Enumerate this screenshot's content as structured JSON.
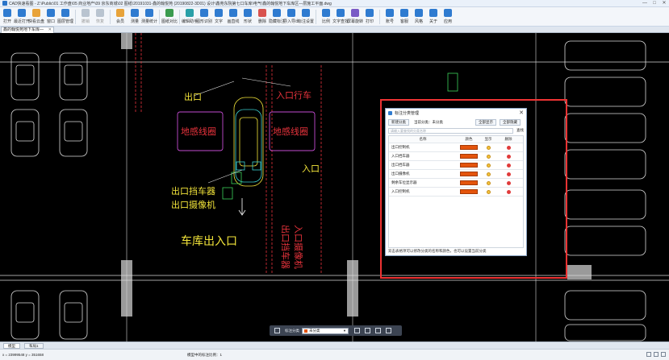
{
  "window": {
    "title": "CAD快速看图 - Z:\\Public\\01 工作盘\\05 商业地产\\09 京东商城\\02 图纸\\20191031-鑫的翰悦苑 (20190822-3D01) 设计\\鑫苑东院第七口车库\\电气\\鑫的翰悦地下车库区—层施工平面.dwg",
    "minimize": "—",
    "maximize": "□",
    "close": "✕"
  },
  "toolbar": {
    "items": [
      {
        "label": "打开",
        "icon": "open-icon",
        "enabled": true
      },
      {
        "label": "最近打开",
        "icon": "recent-icon",
        "enabled": true
      },
      {
        "label": "快看云盘",
        "icon": "cloud-icon",
        "enabled": true
      },
      {
        "label": "窗口",
        "icon": "window-icon",
        "enabled": true
      },
      {
        "label": "图层管理",
        "icon": "layers-icon",
        "enabled": true
      },
      {
        "label": "撤销",
        "icon": "undo-icon",
        "enabled": false
      },
      {
        "label": "恢复",
        "icon": "redo-icon",
        "enabled": false
      },
      {
        "label": "会员",
        "icon": "vip-icon",
        "enabled": true
      },
      {
        "label": "测量",
        "icon": "measure-icon",
        "enabled": true
      },
      {
        "label": "测量统计",
        "icon": "measure-stats-icon",
        "enabled": true
      },
      {
        "label": "图纸对比",
        "icon": "compare-icon",
        "enabled": true
      },
      {
        "label": "编辑助手",
        "icon": "edit-assistant-icon",
        "enabled": true
      },
      {
        "label": "图形识别",
        "icon": "shape-recognize-icon",
        "enabled": true
      },
      {
        "label": "文字",
        "icon": "text-icon",
        "enabled": true
      },
      {
        "label": "画直线",
        "icon": "line-icon",
        "enabled": true
      },
      {
        "label": "形状",
        "icon": "shape-icon",
        "enabled": true
      },
      {
        "label": "删除",
        "icon": "delete-icon",
        "enabled": true
      },
      {
        "label": "隐藏标注",
        "icon": "hide-annotation-icon",
        "enabled": true
      },
      {
        "label": "导入导出",
        "icon": "import-export-icon",
        "enabled": true
      },
      {
        "label": "标注设置",
        "icon": "annotation-settings-icon",
        "enabled": true
      },
      {
        "label": "比例",
        "icon": "scale-icon",
        "enabled": true
      },
      {
        "label": "文字查找",
        "icon": "text-search-icon",
        "enabled": true
      },
      {
        "label": "屏幕旋转",
        "icon": "rotate-icon",
        "enabled": true
      },
      {
        "label": "打印",
        "icon": "print-icon",
        "enabled": true
      },
      {
        "label": "账号",
        "icon": "account-icon",
        "enabled": true
      },
      {
        "label": "客服",
        "icon": "support-icon",
        "enabled": true
      },
      {
        "label": "风格",
        "icon": "style-icon",
        "enabled": true
      },
      {
        "label": "关于",
        "icon": "about-icon",
        "enabled": true
      },
      {
        "label": "应用",
        "icon": "apps-icon",
        "enabled": true
      }
    ]
  },
  "doc_tab": {
    "label": "鑫的翰悦苑地下车库—",
    "close": "✕"
  },
  "canvas": {
    "labels": {
      "exit_top": "出口",
      "entry_top": "入口行车",
      "ground_coil_left": "地感线圈",
      "ground_coil_right": "地感线圈",
      "entry_mid": "入口",
      "exit_barrier": "出口挡车器",
      "exit_camera": "出口摄像机",
      "garage_exit": "车库出入口",
      "vertical_left": "出口挡车器",
      "vertical_right": "入口摄像机"
    },
    "colors": {
      "red_text": "#e8333c",
      "yellow_text": "#f3e53a",
      "green_text": "#3bd15a",
      "white_lines": "#e9e9e9",
      "grey_columns": "#9a9a9a"
    }
  },
  "dialog": {
    "title": "标注分类管理",
    "close": "✕",
    "new_category": "新建分类",
    "current_category_label": "当前分类：未分类",
    "show_all": "全部显示",
    "hide_all": "全部隐藏",
    "search_placeholder": "请输入要查找的分类名称",
    "find": "查找",
    "columns": {
      "name": "名称",
      "color": "颜色",
      "show": "显示",
      "delete": "删除"
    },
    "rows": [
      {
        "name": "出口控制机",
        "color": "#e4540c"
      },
      {
        "name": "入口挡车器",
        "color": "#e4540c"
      },
      {
        "name": "出口挡车器",
        "color": "#e4540c"
      },
      {
        "name": "出口摄像机",
        "color": "#e4540c"
      },
      {
        "name": "剩余车位显示器",
        "color": "#e4540c"
      },
      {
        "name": "入口控制机",
        "color": "#e4540c"
      }
    ],
    "footer": "双击表格项可以修改分类的名称和颜色，也可以设置当前分类"
  },
  "float_bar": {
    "category_label": "标注分类",
    "selected_category": "未分类"
  },
  "layout_tabs": [
    {
      "label": "模型",
      "active": true
    },
    {
      "label": "布局1",
      "active": false
    }
  ],
  "status": {
    "coord": "x = 23999548  y = 351658",
    "scale": "模型中的标注比例：1"
  }
}
